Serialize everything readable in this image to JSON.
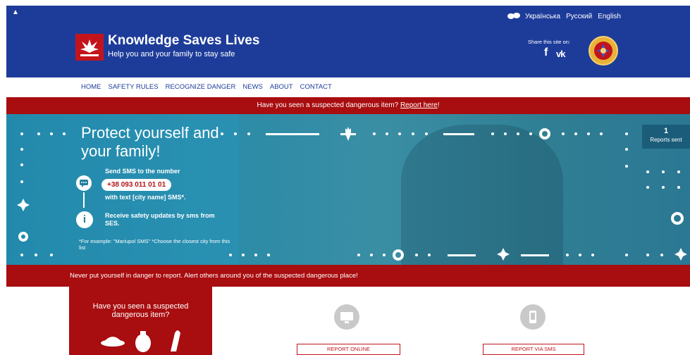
{
  "header": {
    "title": "Knowledge Saves Lives",
    "tagline": "Help you and your family to stay safe",
    "languages": [
      "Українська",
      "Русский",
      "English"
    ],
    "share_label": "Share this site on:",
    "share_facebook": "f",
    "share_vk": "vk"
  },
  "nav": {
    "items": [
      "HOME",
      "SAFETY RULES",
      "RECOGNIZE DANGER",
      "NEWS",
      "ABOUT",
      "CONTACT"
    ]
  },
  "alert": {
    "text": "Have you seen a suspected dangerous item?",
    "link": "Report here",
    "suffix": "!"
  },
  "hero": {
    "title": "Protect yourself and your family!",
    "sms_line1": "Send SMS to the number",
    "phone": "+38 093 011 01 01",
    "sms_line2": "with text [city name] SMS*.",
    "sms_line3": "Receive safety updates by sms from SES.",
    "footnote": "*For example: \"Mariupol SMS\" *Choose the closest city from this list",
    "reports_count": "1",
    "reports_label": "Reports sent"
  },
  "warning": {
    "text": "Never put yourself in danger to report. Alert others around you of the suspected dangerous place!"
  },
  "report_card": {
    "title": "Have you seen a suspected dangerous item?"
  },
  "report_online": {
    "label": "REPORT ONLINE"
  },
  "report_sms": {
    "label": "REPORT VIA SMS"
  },
  "colors": {
    "header_blue": "#1d3c9a",
    "alert_red": "#a80d0f",
    "hero_teal": "#2a8ba8",
    "icon_grey": "#c9c9c9"
  },
  "icons": [
    "logo-icon",
    "globe-icon",
    "facebook-icon",
    "vk-icon",
    "emblem-icon",
    "sms-icon",
    "info-icon",
    "landmine-icon",
    "grenade-icon",
    "shell-icon",
    "monitor-icon",
    "phone-icon"
  ]
}
